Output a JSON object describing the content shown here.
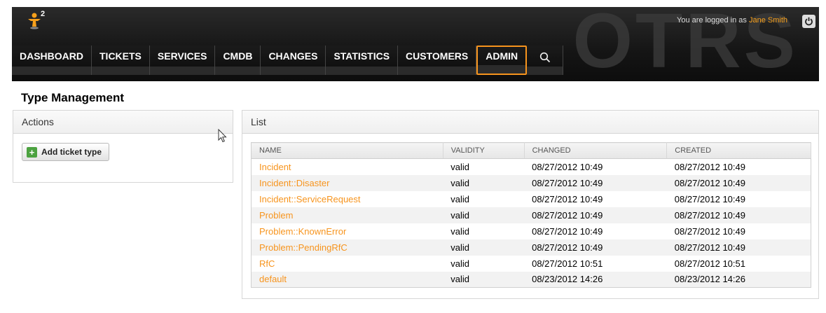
{
  "header": {
    "logo_badge": "2",
    "watermark": "OTRS",
    "login_prefix": "You are logged in as",
    "user_name": "Jane Smith"
  },
  "nav": {
    "items": [
      {
        "label": "DASHBOARD"
      },
      {
        "label": "TICKETS"
      },
      {
        "label": "SERVICES"
      },
      {
        "label": "CMDB"
      },
      {
        "label": "CHANGES"
      },
      {
        "label": "STATISTICS"
      },
      {
        "label": "CUSTOMERS"
      },
      {
        "label": "ADMIN"
      }
    ],
    "search_icon": "search-icon"
  },
  "page": {
    "title": "Type Management"
  },
  "actions": {
    "title": "Actions",
    "add_label": "Add ticket type"
  },
  "list": {
    "title": "List",
    "columns": [
      "NAME",
      "VALIDITY",
      "CHANGED",
      "CREATED"
    ],
    "rows": [
      {
        "name": "Incident",
        "validity": "valid",
        "changed": "08/27/2012 10:49",
        "created": "08/27/2012 10:49"
      },
      {
        "name": "Incident::Disaster",
        "validity": "valid",
        "changed": "08/27/2012 10:49",
        "created": "08/27/2012 10:49"
      },
      {
        "name": "Incident::ServiceRequest",
        "validity": "valid",
        "changed": "08/27/2012 10:49",
        "created": "08/27/2012 10:49"
      },
      {
        "name": "Problem",
        "validity": "valid",
        "changed": "08/27/2012 10:49",
        "created": "08/27/2012 10:49"
      },
      {
        "name": "Problem::KnownError",
        "validity": "valid",
        "changed": "08/27/2012 10:49",
        "created": "08/27/2012 10:49"
      },
      {
        "name": "Problem::PendingRfC",
        "validity": "valid",
        "changed": "08/27/2012 10:49",
        "created": "08/27/2012 10:49"
      },
      {
        "name": "RfC",
        "validity": "valid",
        "changed": "08/27/2012 10:51",
        "created": "08/27/2012 10:51"
      },
      {
        "name": "default",
        "validity": "valid",
        "changed": "08/23/2012 14:26",
        "created": "08/23/2012 14:26"
      }
    ]
  },
  "colors": {
    "accent": "#f7941d",
    "header_bg": "#1a1a1a",
    "link": "#f7941d"
  }
}
